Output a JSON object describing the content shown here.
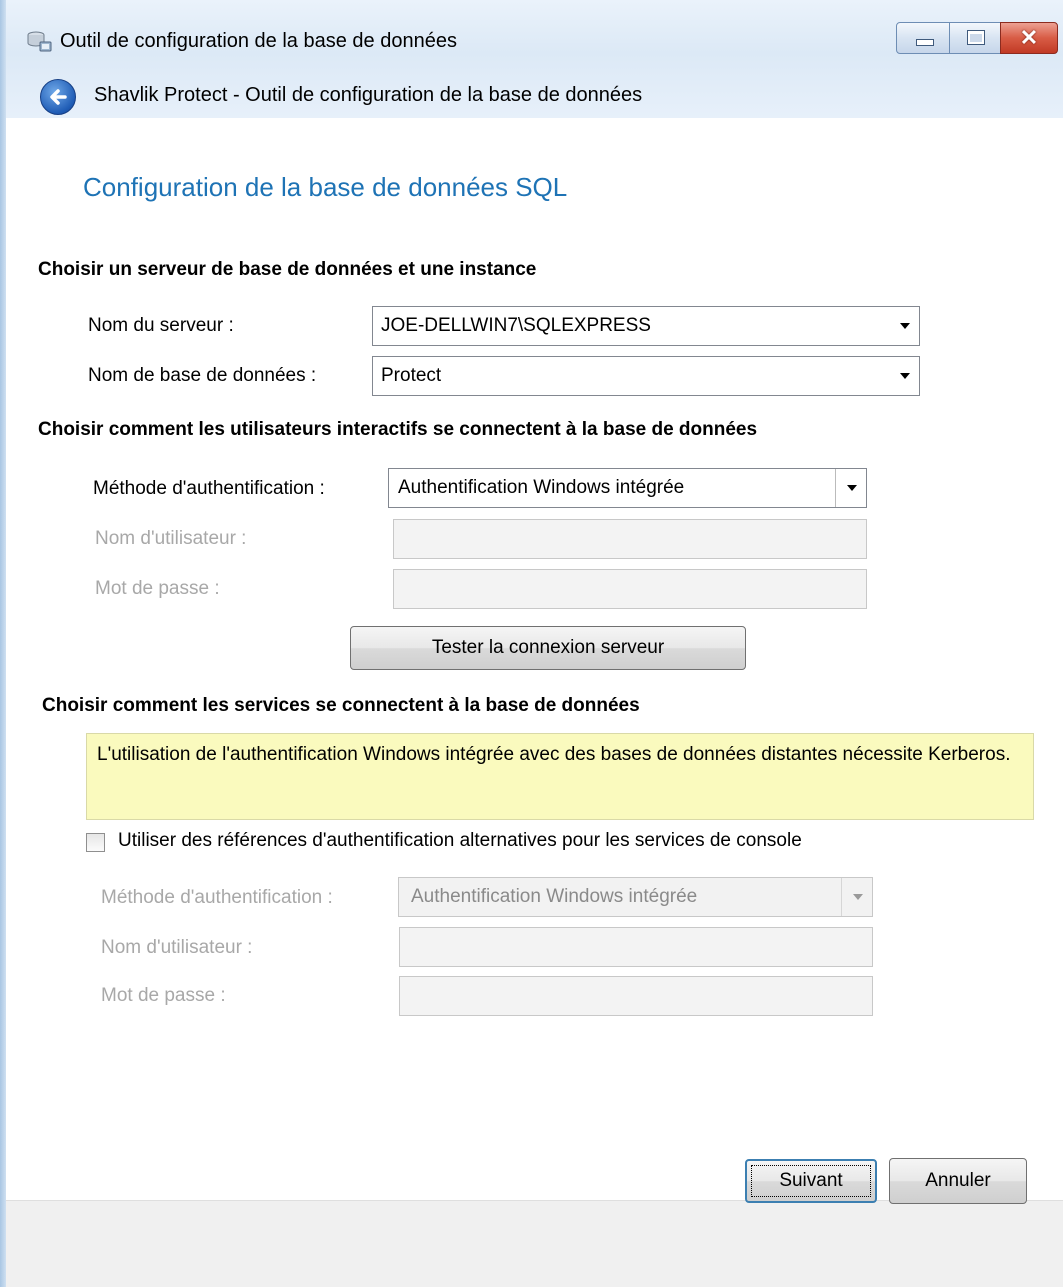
{
  "window": {
    "title": "Outil de configuration de la base de données",
    "header_title": "Shavlik Protect - Outil de configuration de la base de données",
    "close_glyph": "✕"
  },
  "page": {
    "heading": "Configuration de la base de données SQL"
  },
  "server_section": {
    "heading": "Choisir un serveur de base de données et une instance",
    "server_name_label": "Nom du serveur :",
    "server_name_value": "JOE-DELLWIN7\\SQLEXPRESS",
    "database_name_label": "Nom de base de données :",
    "database_name_value": "Protect"
  },
  "interactive_section": {
    "heading": "Choisir comment les utilisateurs interactifs se connectent à la base de données",
    "auth_method_label": "Méthode d'authentification :",
    "auth_method_value": "Authentification Windows intégrée",
    "username_label": "Nom d'utilisateur :",
    "password_label": "Mot de passe :",
    "test_button": "Tester la connexion serveur"
  },
  "services_section": {
    "heading": "Choisir comment les services se connectent à la base de données",
    "info_text": "L'utilisation de l'authentification Windows intégrée avec des bases de données distantes nécessite Kerberos.",
    "checkbox_label": "Utiliser des références d'authentification alternatives pour les services de console",
    "checkbox_checked": false,
    "auth_method_label": "Méthode d'authentification :",
    "auth_method_value": "Authentification Windows intégrée",
    "username_label": "Nom d'utilisateur :",
    "password_label": "Mot de passe :"
  },
  "footer": {
    "next_button": "Suivant",
    "cancel_button": "Annuler"
  },
  "colors": {
    "heading_blue": "#1e73b5",
    "info_background": "#fafabe",
    "disabled_text": "#a8a8a8"
  },
  "icons": [
    "database-icon",
    "back-arrow-icon",
    "minimize-icon",
    "maximize-icon",
    "close-icon",
    "dropdown-arrow-icon"
  ]
}
